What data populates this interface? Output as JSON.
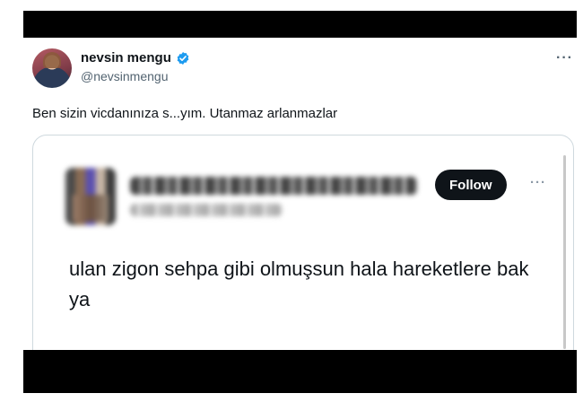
{
  "tweet": {
    "author_name": "nevsin mengu",
    "author_handle": "@nevsinmengu",
    "more_label": "···",
    "text": "Ben sizin vicdanınıza s...yım. Utanmaz arlanmazlar"
  },
  "quoted": {
    "follow_label": "Follow",
    "more_label": "···",
    "text": "ulan zigon sehpa gibi olmuşsun hala hareketlere bak ya"
  },
  "colors": {
    "verified": "#1d9bf0",
    "follow_bg": "#0f1419",
    "secondary_text": "#536471"
  }
}
